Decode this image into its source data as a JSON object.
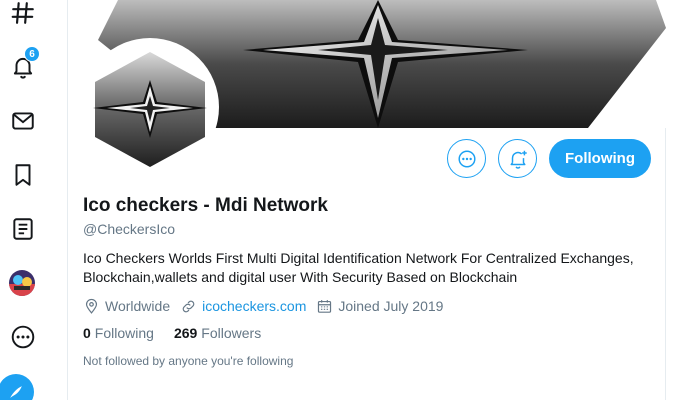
{
  "sidebar": {
    "notifications_badge": "6",
    "items": [
      {
        "name": "explore",
        "icon": "hashtag-icon"
      },
      {
        "name": "notifications",
        "icon": "bell-icon"
      },
      {
        "name": "messages",
        "icon": "mail-icon"
      },
      {
        "name": "bookmarks",
        "icon": "bookmark-icon"
      },
      {
        "name": "lists",
        "icon": "list-icon"
      },
      {
        "name": "profile",
        "icon": "avatar"
      },
      {
        "name": "more",
        "icon": "more-circle-icon"
      },
      {
        "name": "compose",
        "icon": "compose-icon"
      }
    ]
  },
  "actions": {
    "more_icon": "more-icon",
    "notify_icon": "bell-plus-icon",
    "follow_label": "Following"
  },
  "profile": {
    "name": "Ico checkers - Mdi Network",
    "handle": "@CheckersIco",
    "bio": "Ico Checkers Worlds First Multi Digital Identification Network For Centralized Exchanges, Blockchain,wallets and digital user  With Security Based on Blockchain",
    "location": "Worldwide",
    "website": "icocheckers.com",
    "joined": "Joined July 2019",
    "following_count": "0",
    "following_label": "Following",
    "followers_count": "269",
    "followers_label": "Followers",
    "followed_note": "Not followed by anyone you're following"
  },
  "colors": {
    "accent": "#1da1f2",
    "text": "#14171a",
    "muted": "#657786"
  }
}
